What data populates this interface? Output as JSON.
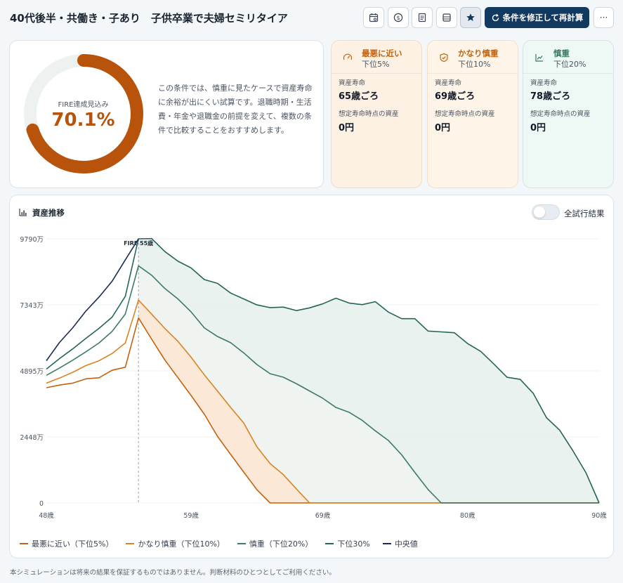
{
  "header": {
    "title": "40代後半・共働き・子あり　子供卒業で夫婦セミリタイア",
    "recalc_label": "条件を修正して再計算",
    "more_label": "···",
    "icons": [
      "calendar-icon",
      "coin-icon",
      "document-icon",
      "database-icon",
      "star-icon"
    ]
  },
  "summary": {
    "donut_label": "FIRE達成見込み",
    "donut_value": "70.1%",
    "probability": 0.701,
    "description": "この条件では、慎重に見たケースで資産寿命に余裕が出にくい試算です。退職時期・生活費・年金や退職金の前提を変えて、複数の条件で比較することをおすすめします。"
  },
  "scenarios": [
    {
      "title": "最悪に近い",
      "percentile": "下位5%",
      "life_label": "資産寿命",
      "life_value": "65歳ごろ",
      "end_label": "想定寿命時点の資産",
      "end_value": "0円",
      "accent": "#c2620f",
      "bg": "#fdf1e4",
      "border": "#f3dcc3",
      "icon": "gauge-icon"
    },
    {
      "title": "かなり慎重",
      "percentile": "下位10%",
      "life_label": "資産寿命",
      "life_value": "69歳ごろ",
      "end_label": "想定寿命時点の資産",
      "end_value": "0円",
      "accent": "#c2620f",
      "bg": "#fef5e8",
      "border": "#f3e0c4",
      "icon": "shield-icon"
    },
    {
      "title": "慎重",
      "percentile": "下位20%",
      "life_label": "資産寿命",
      "life_value": "78歳ごろ",
      "end_label": "想定寿命時点の資産",
      "end_value": "0円",
      "accent": "#3d7a68",
      "bg": "#eef8f4",
      "border": "#d2e6df",
      "icon": "trend-icon"
    }
  ],
  "chart": {
    "title": "資産推移",
    "toggle_label": "全試行結果",
    "toggle_on": false,
    "fire_marker_label": "FIRE 55歳",
    "footnote": "本シミュレーションは将来の結果を保証するものではありません。判断材料のひとつとしてご利用ください。"
  },
  "chart_data": {
    "type": "line",
    "x": [
      48,
      49,
      50,
      51,
      52,
      53,
      54,
      55,
      56,
      57,
      58,
      59,
      60,
      61,
      62,
      63,
      64,
      65,
      66,
      67,
      68,
      69,
      70,
      71,
      72,
      73,
      74,
      75,
      76,
      77,
      78,
      79,
      80,
      81,
      82,
      83,
      84,
      85,
      86,
      87,
      88,
      89,
      90
    ],
    "ylim": [
      0,
      9790
    ],
    "yticks": [
      0,
      2448,
      4895,
      7343,
      9790
    ],
    "ytick_labels": [
      "0",
      "2448万",
      "4895万",
      "7343万",
      "9790万"
    ],
    "xticks": [
      48,
      59,
      69,
      80,
      90
    ],
    "xtick_labels": [
      "48歳",
      "59歳",
      "69歳",
      "80歳",
      "90歳"
    ],
    "fire_age": 55,
    "legend_position": "bottom-left",
    "series": [
      {
        "name": "最悪に近い（下位5%）",
        "color": "#c2620f",
        "values": [
          4270,
          4370,
          4440,
          4600,
          4640,
          4920,
          5030,
          6860,
          6070,
          5300,
          4640,
          3980,
          3290,
          2470,
          1800,
          1140,
          490,
          0,
          0,
          0,
          0,
          0,
          0,
          0,
          0,
          0,
          0,
          0,
          0,
          0,
          0,
          0,
          0,
          0,
          0,
          0,
          0,
          0,
          0,
          0,
          0,
          0,
          0
        ]
      },
      {
        "name": "かなり慎重（下位10%）",
        "color": "#d98324",
        "values": [
          4440,
          4630,
          4840,
          5090,
          5270,
          5540,
          5930,
          7520,
          7000,
          6470,
          5990,
          5400,
          4750,
          4150,
          3540,
          2960,
          2080,
          1460,
          1050,
          520,
          0,
          0,
          0,
          0,
          0,
          0,
          0,
          0,
          0,
          0,
          0,
          0,
          0,
          0,
          0,
          0,
          0,
          0,
          0,
          0,
          0,
          0,
          0
        ]
      },
      {
        "name": "慎重（下位20%）",
        "color": "#3d7a68",
        "values": [
          4730,
          5000,
          5290,
          5600,
          5930,
          6360,
          7000,
          8790,
          8440,
          7950,
          7560,
          7080,
          6490,
          6170,
          5940,
          5560,
          5130,
          4790,
          4660,
          4420,
          4150,
          3880,
          3540,
          3360,
          3060,
          2670,
          2310,
          1780,
          1130,
          500,
          0,
          0,
          0,
          0,
          0,
          0,
          0,
          0,
          0,
          0,
          0,
          0,
          0
        ]
      },
      {
        "name": "下位30%",
        "color": "#24655a",
        "values": [
          4960,
          5350,
          5710,
          6100,
          6470,
          6890,
          7660,
          9790,
          9800,
          9320,
          8960,
          8710,
          8280,
          8140,
          7780,
          7560,
          7340,
          7240,
          7260,
          7130,
          7230,
          7380,
          7590,
          7410,
          7350,
          7460,
          7070,
          6830,
          6830,
          6370,
          6340,
          6310,
          5910,
          5620,
          5150,
          4660,
          4580,
          4060,
          3160,
          2700,
          1940,
          1120,
          0
        ]
      },
      {
        "name": "中央値",
        "color": "#1a2a5a",
        "values": [
          5270,
          5950,
          6490,
          7110,
          7630,
          8220,
          9010,
          9790
        ]
      }
    ]
  }
}
